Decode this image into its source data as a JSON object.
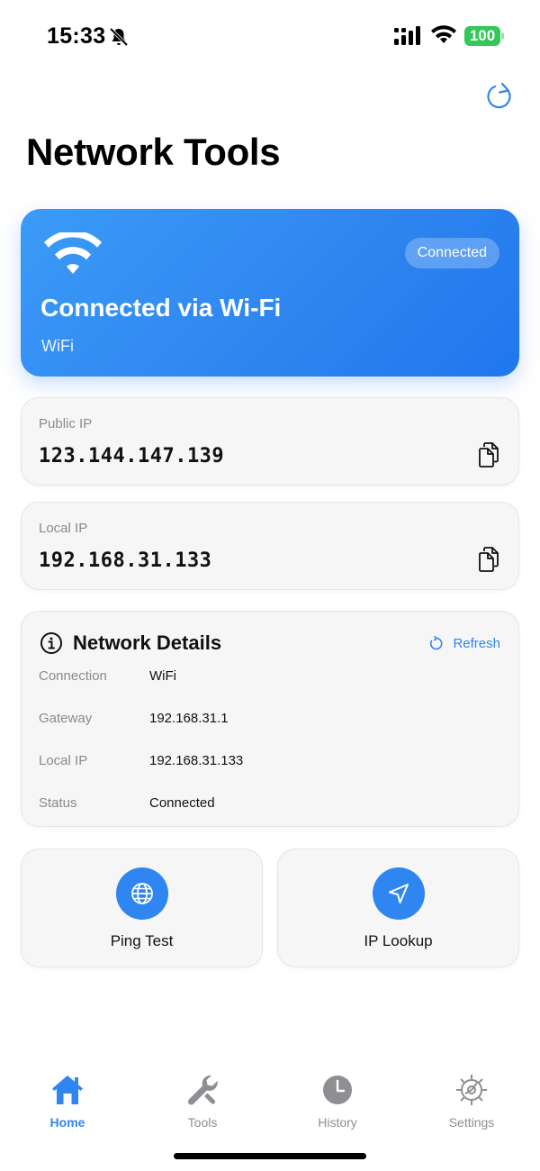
{
  "status_bar": {
    "time": "15:33",
    "battery": "100",
    "icons": [
      "bell-slash-icon",
      "cellular-signal-icon",
      "wifi-icon",
      "battery-icon"
    ]
  },
  "header": {
    "title": "Network Tools",
    "refresh_icon": "refresh-icon"
  },
  "connection": {
    "badge": "Connected",
    "title": "Connected via Wi-Fi",
    "subtitle": "WiFi",
    "icon": "wifi-icon",
    "gradient": [
      "#3b9bf7",
      "#1f77ed"
    ]
  },
  "public_ip": {
    "label": "Public IP",
    "value": "123.144.147.139",
    "icon": "copy-icon"
  },
  "local_ip": {
    "label": "Local IP",
    "value": "192.168.31.133",
    "icon": "copy-icon"
  },
  "details": {
    "title": "Network Details",
    "refresh_label": "Refresh",
    "rows": [
      {
        "key": "Connection",
        "value": "WiFi"
      },
      {
        "key": "Gateway",
        "value": "192.168.31.1"
      },
      {
        "key": "Local IP",
        "value": "192.168.31.133"
      },
      {
        "key": "Status",
        "value": "Connected"
      }
    ]
  },
  "tools": [
    {
      "label": "Ping Test",
      "icon": "globe-icon"
    },
    {
      "label": "IP Lookup",
      "icon": "location-arrow-icon"
    }
  ],
  "tabs": [
    {
      "label": "Home",
      "icon": "house-icon",
      "active": true
    },
    {
      "label": "Tools",
      "icon": "wrench-icon",
      "active": false
    },
    {
      "label": "History",
      "icon": "clock-icon",
      "active": false
    },
    {
      "label": "Settings",
      "icon": "gear-icon",
      "active": false
    }
  ],
  "colors": {
    "accent": "#2f86f0",
    "battery_green": "#34c759",
    "card_bg": "#f6f6f7",
    "muted_text": "#8a8a8e"
  }
}
